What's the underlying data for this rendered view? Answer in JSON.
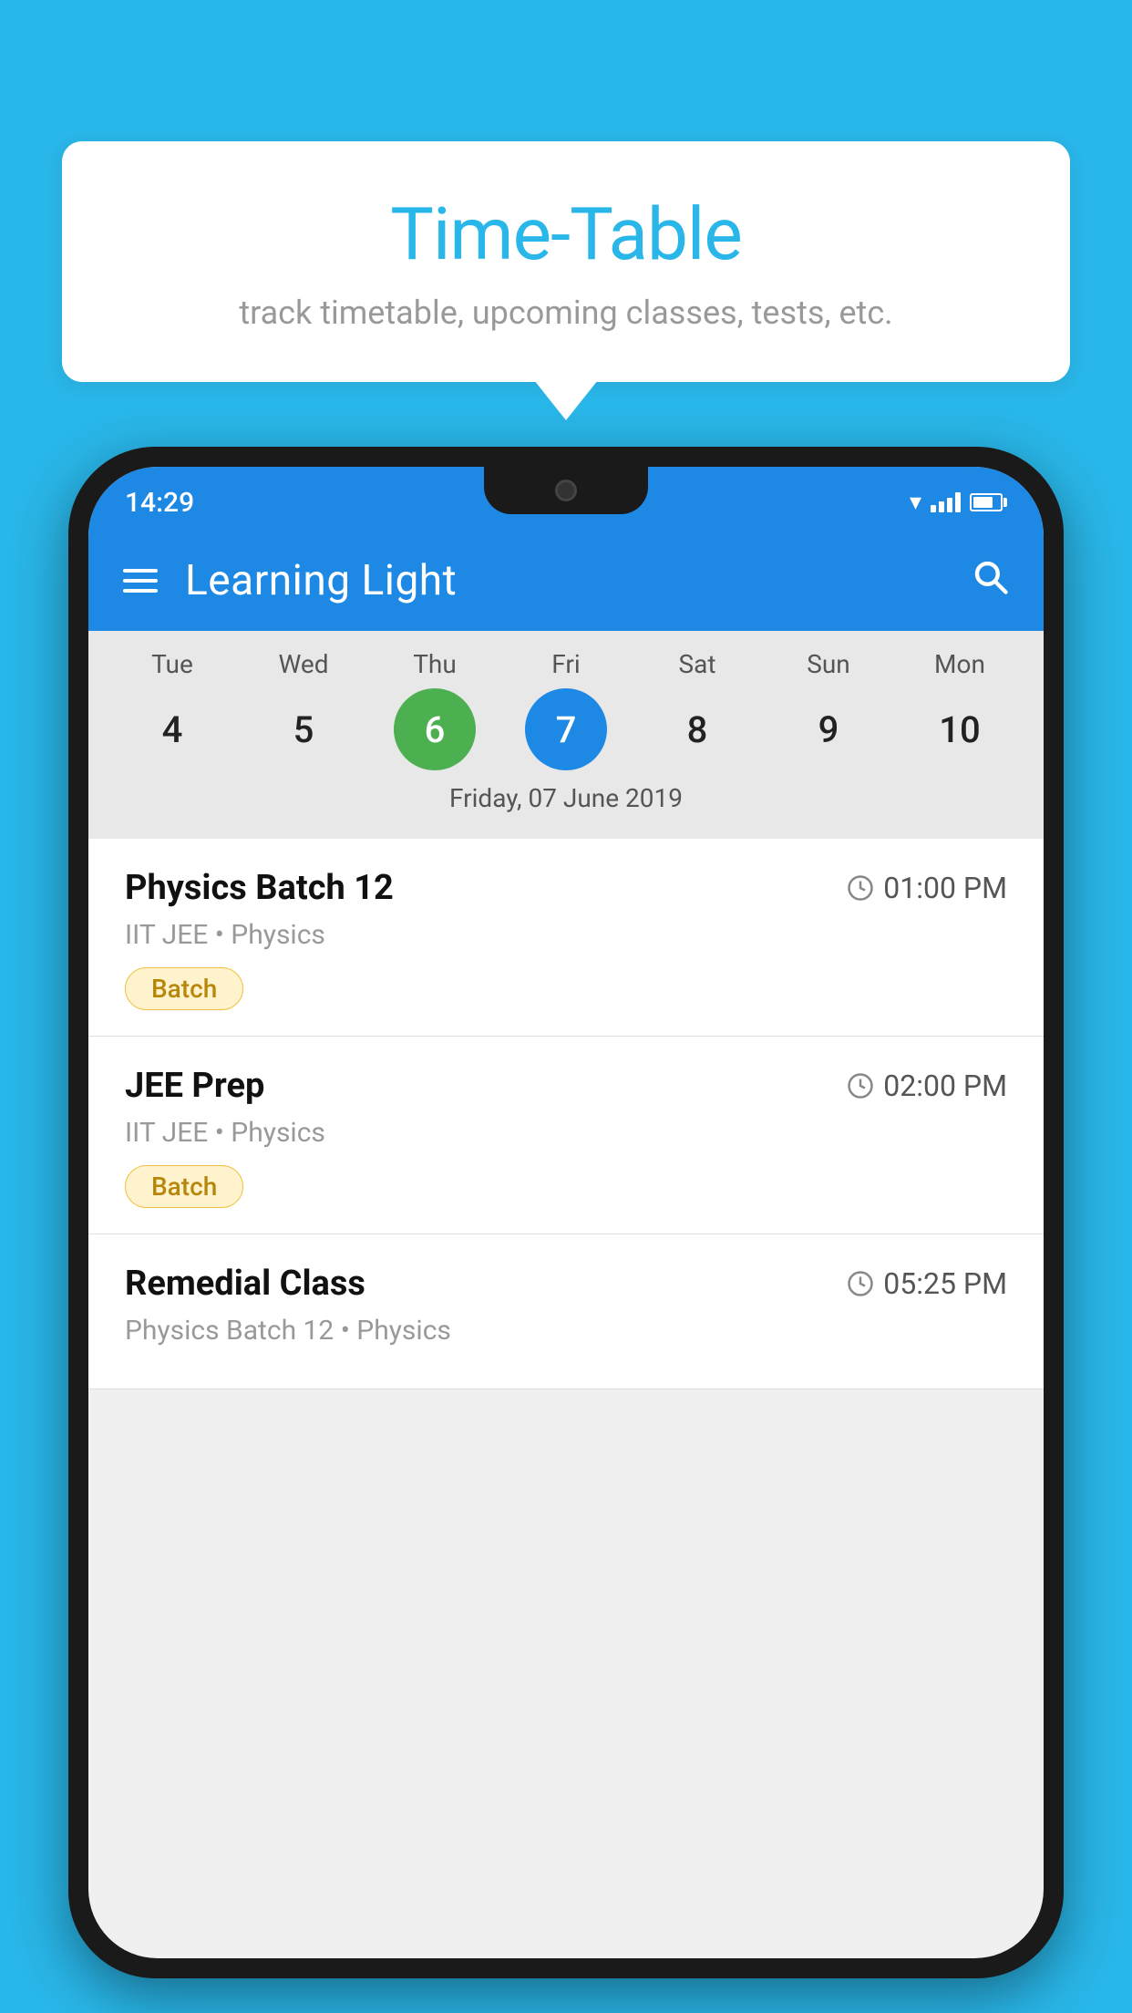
{
  "background_color": "#29B6E8",
  "bubble": {
    "title": "Time-Table",
    "subtitle": "track timetable, upcoming classes, tests, etc."
  },
  "phone": {
    "status_bar": {
      "time": "14:29"
    },
    "app_bar": {
      "title": "Learning Light"
    },
    "calendar": {
      "days": [
        {
          "label": "Tue",
          "number": "4"
        },
        {
          "label": "Wed",
          "number": "5"
        },
        {
          "label": "Thu",
          "number": "6",
          "state": "today"
        },
        {
          "label": "Fri",
          "number": "7",
          "state": "selected"
        },
        {
          "label": "Sat",
          "number": "8"
        },
        {
          "label": "Sun",
          "number": "9"
        },
        {
          "label": "Mon",
          "number": "10"
        }
      ],
      "selected_date_label": "Friday, 07 June 2019"
    },
    "classes": [
      {
        "name": "Physics Batch 12",
        "time": "01:00 PM",
        "meta": "IIT JEE • Physics",
        "tag": "Batch"
      },
      {
        "name": "JEE Prep",
        "time": "02:00 PM",
        "meta": "IIT JEE • Physics",
        "tag": "Batch"
      },
      {
        "name": "Remedial Class",
        "time": "05:25 PM",
        "meta": "Physics Batch 12 • Physics",
        "tag": null
      }
    ]
  }
}
